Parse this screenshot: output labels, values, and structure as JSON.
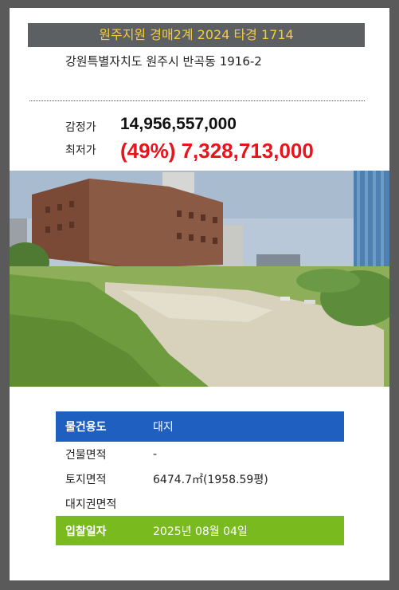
{
  "header": {
    "title": "원주지원 경매2계 2024 타경 1714",
    "address": "강원특별자치도 원주시 반곡동 1916-2"
  },
  "prices": {
    "appraisal_label": "감정가",
    "appraisal_value": "14,956,557,000",
    "minimum_label": "최저가",
    "minimum_value": "(49%) 7,328,713,000"
  },
  "photo": {
    "icon": "property-photo"
  },
  "details": {
    "usage_label": "물건용도",
    "usage_value": "대지",
    "building_area_label": "건물면적",
    "building_area_value": "-",
    "land_area_label": "토지면적",
    "land_area_value": "6474.7㎡(1958.59평)",
    "land_right_label": "대지권면적",
    "land_right_value": "",
    "bid_date_label": "입찰일자",
    "bid_date_value": "2025년 08월 04일"
  },
  "colors": {
    "title_bg": "#5d6063",
    "title_text": "#f3cc3f",
    "price_red": "#e8141c",
    "usage_blue": "#1e5fc0",
    "bid_green": "#79ba1f"
  }
}
